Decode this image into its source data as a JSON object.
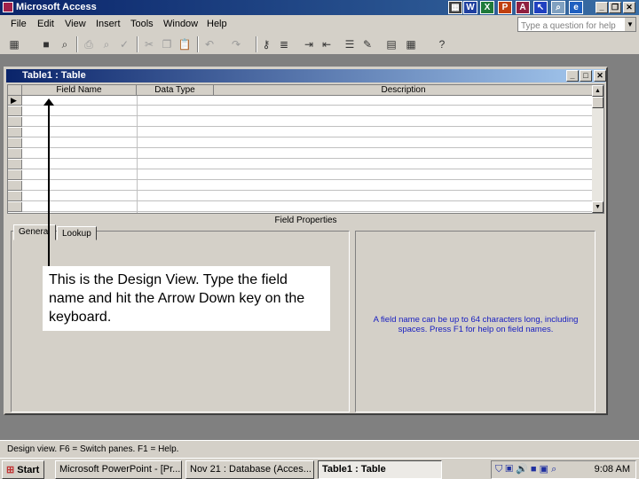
{
  "app": {
    "title": "Microsoft Access"
  },
  "menu": [
    "File",
    "Edit",
    "View",
    "Insert",
    "Tools",
    "Window",
    "Help"
  ],
  "help_box": {
    "placeholder": "Type a question for help"
  },
  "window": {
    "title": "Table1 : Table",
    "columns": [
      "Field Name",
      "Data Type",
      "Description"
    ],
    "field_properties_label": "Field Properties",
    "tabs": [
      "General",
      "Lookup"
    ],
    "help_text": "A field name can be up to 64 characters long, including spaces. Press F1 for help on field names."
  },
  "callout": "This is the Design View.  Type the field name and hit the Arrow Down key on the keyboard.",
  "status": "Design view.  F6 = Switch panes.  F1 = Help.",
  "taskbar": {
    "start": "Start",
    "tasks": [
      "Microsoft PowerPoint - [Pr...",
      "Nov 21 : Database (Acces...",
      "Table1 : Table"
    ],
    "clock": "9:08 AM"
  }
}
